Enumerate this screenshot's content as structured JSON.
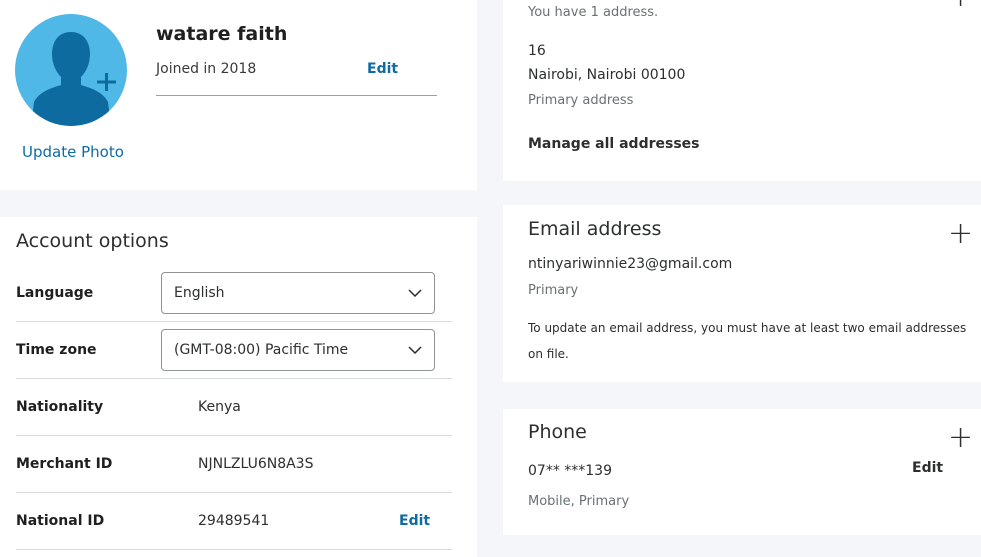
{
  "profile": {
    "name": "watare faith",
    "joined": "Joined in 2018",
    "edit_label": "Edit",
    "update_photo": "Update Photo"
  },
  "account_options": {
    "title": "Account options",
    "language": {
      "label": "Language",
      "value": "English"
    },
    "timezone": {
      "label": "Time zone",
      "value": "(GMT-08:00) Pacific Time"
    },
    "nationality": {
      "label": "Nationality",
      "value": "Kenya"
    },
    "merchant_id": {
      "label": "Merchant ID",
      "value": "NJNLZLU6N8A3S"
    },
    "national_id": {
      "label": "National ID",
      "value": "29489541",
      "edit_label": "Edit"
    }
  },
  "address": {
    "count_text": "You have 1 address.",
    "line1": "16",
    "line2": "Nairobi, Nairobi 00100",
    "type": "Primary address",
    "manage_link": "Manage all addresses",
    "add_icon": "plus-icon"
  },
  "email": {
    "title": "Email address",
    "address": "ntinyariwinnie23@gmail.com",
    "type": "Primary",
    "note": "To update an email address, you must have at least two email addresses on file.",
    "add_icon": "plus-icon"
  },
  "phone": {
    "title": "Phone",
    "number": "07** ***139",
    "type": "Mobile, Primary",
    "edit_label": "Edit",
    "add_icon": "plus-icon"
  },
  "colors": {
    "link": "#0f6ba3",
    "avatar_bg": "#4fb8e7",
    "avatar_figure": "#0e6ba0",
    "page_bg": "#f5f6f9"
  }
}
